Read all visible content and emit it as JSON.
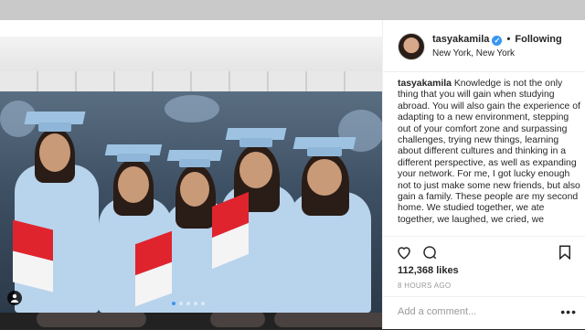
{
  "post": {
    "username": "tasyakamila",
    "follow_separator": "•",
    "follow_label": "Following",
    "location": "New York, New York",
    "caption_user": "tasyakamila",
    "caption_text": " Knowledge is not the only thing that you will gain when studying abroad. You will also gain the experience of adapting to a new environment, stepping out of your comfort zone and surpassing challenges, trying new things, learning about different cultures and thinking in a different perspective, as well as expanding your network. For me, I got lucky enough not to just make some new friends, but also gain a family. These people are my second home. We studied together, we ate together, we laughed, we cried, we",
    "likes": "112,368 likes",
    "time_ago": "8 HOURS AGO",
    "comment_placeholder": "Add a comment...",
    "more_label": "•••"
  },
  "icons": {
    "verified": "verified-check-icon",
    "heart": "heart-icon",
    "comment": "comment-icon",
    "bookmark": "bookmark-icon",
    "user_tag": "person-tag-icon",
    "more": "more-options-icon"
  },
  "colors": {
    "accent": "#3897f0",
    "text": "#262626",
    "muted": "#999999",
    "gown": "#b8d3ec",
    "flag_red": "#e0242e"
  },
  "carousel": {
    "count": 5,
    "active": 1
  }
}
